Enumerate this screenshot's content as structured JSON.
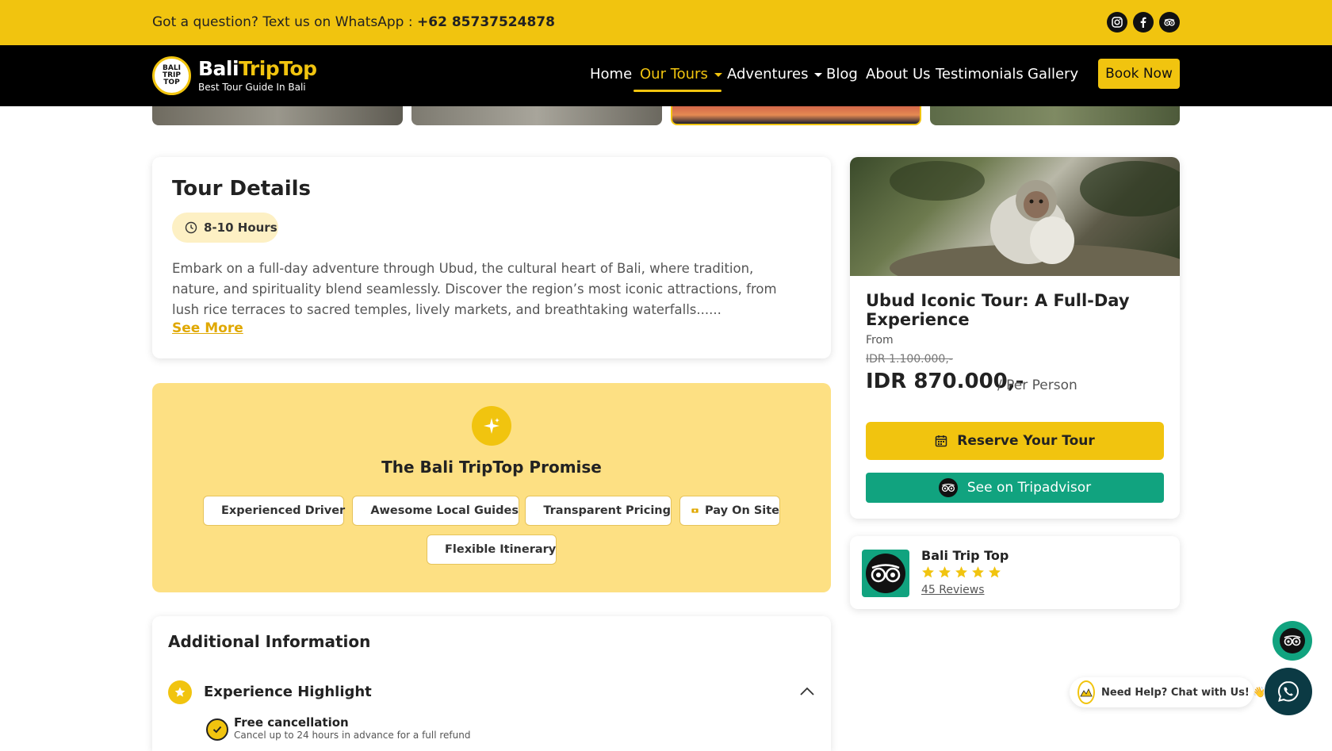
{
  "topbar": {
    "question_prefix": "Got a question? Text us on WhatsApp :",
    "phone": "+62 85737524878",
    "social_icons": [
      "instagram-icon",
      "facebook-icon",
      "tripadvisor-icon"
    ]
  },
  "navbar": {
    "brand_main": "Bali",
    "brand_accent": "TripTop",
    "brand_sub": "Best Tour Guide In Bali",
    "logo_text": "BALI TRIP TOP",
    "items": [
      "Home",
      "Our Tours",
      "Adventures",
      "Blog",
      "About Us",
      "Testimonials",
      "Gallery"
    ],
    "active_item": "Our Tours",
    "book_label": "Book Now"
  },
  "tour_details": {
    "title": "Tour Details",
    "duration": "8-10 Hours",
    "description": "Embark on a full-day adventure through Ubud, the cultural heart of Bali, where tradition, nature, and spirituality blend seamlessly. Discover the region’s most iconic attractions, from lush rice terraces to sacred temples, lively markets, and breathtaking waterfalls......",
    "see_more": "See More"
  },
  "promise": {
    "title": "The Bali TripTop Promise",
    "chips": [
      "Experienced Driver",
      "Awesome Local Guides",
      "Transparent Pricing",
      "Pay On Site",
      "Flexible Itinerary"
    ]
  },
  "additional": {
    "title": "Additional Information",
    "highlight_title": "Experience Highlight",
    "free_cancel_title": "Free cancellation",
    "free_cancel_sub": "Cancel up to 24 hours in advance for a full refund"
  },
  "booking_card": {
    "tour_name": "Ubud Iconic Tour: A Full-Day Experience",
    "from_label": "From",
    "old_price": "IDR 1.100.000,-",
    "price": "IDR 870.000,-",
    "per_person": "/ Per Person",
    "reserve_label": "Reserve Your Tour",
    "tripadvisor_label": "See on Tripadvisor"
  },
  "reviews": {
    "name": "Bali Trip Top",
    "rating": 5,
    "count_label": "45 Reviews"
  },
  "help": {
    "label": "Need Help? Chat with Us! 👋"
  },
  "colors": {
    "accent": "#f1c40f",
    "promise_bg": "#fde083",
    "tripadvisor": "#11a37f",
    "navbar": "#000000"
  }
}
